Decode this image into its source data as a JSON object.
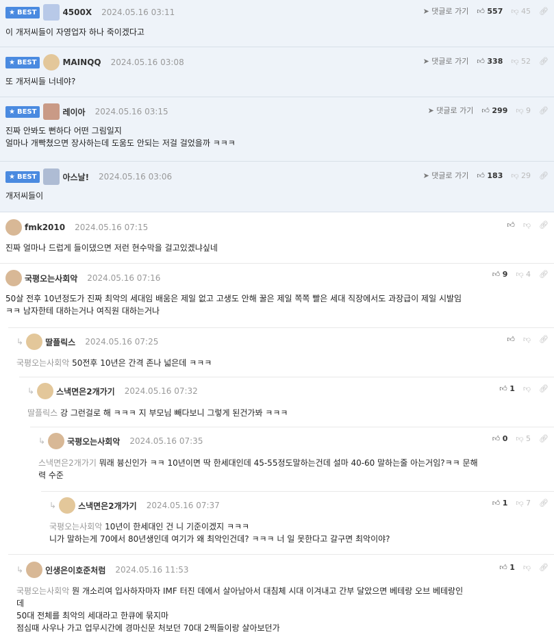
{
  "best_label": "BEST",
  "goto_label": "댓글로 가기",
  "best_comments": [
    {
      "nick": "4500X",
      "date": "2024.05.16 03:11",
      "likes": "557",
      "dislikes": "45",
      "lines": [
        "이 개저씨들이 자영업자 하나 죽이겠다고"
      ]
    },
    {
      "nick": "MAINQQ",
      "date": "2024.05.16 03:08",
      "likes": "338",
      "dislikes": "52",
      "lines": [
        "또 개저씨들 너네야?"
      ]
    },
    {
      "nick": "레이아",
      "date": "2024.05.16 03:15",
      "likes": "299",
      "dislikes": "9",
      "lines": [
        "진짜 안봐도 뻔하다 어떤 그림일지",
        "얼마나 개빡쳤으면 장사하는데 도움도 안되는 저걸 걸었을까 ㅋㅋㅋ"
      ]
    },
    {
      "nick": "아스날!",
      "date": "2024.05.16 03:06",
      "likes": "183",
      "dislikes": "29",
      "lines": [
        "개저씨들이"
      ]
    }
  ],
  "comments": [
    {
      "nick": "fmk2010",
      "date": "2024.05.16 07:15",
      "likes": "",
      "dislikes": "",
      "mention": "",
      "lines": [
        "진짜 얼마나 드럽게 들이댔으면 저런 현수막을 걸고있겠냐싶네"
      ]
    },
    {
      "nick": "국평오는사회악",
      "date": "2024.05.16 07:16",
      "likes": "9",
      "dislikes": "4",
      "mention": "",
      "lines": [
        "50살 전후 10년정도가 진짜 최악의 세대임 배움은 제일 없고 고생도 안해 꿀은 제일 쪽쪽 빨은 세대 직장에서도 과장급이 제일 시발임",
        "ㅋㅋ 남자한테 대하는거나 여직원 대하는거나"
      ]
    },
    {
      "nick": "딸플릭스",
      "date": "2024.05.16 07:25",
      "likes": "",
      "dislikes": "",
      "mention": "국평오는사회악",
      "lines": [
        "50전후 10년은 간격 존나 넓은데 ㅋㅋㅋ"
      ]
    },
    {
      "nick": "스낵면은2개가기",
      "date": "2024.05.16 07:32",
      "likes": "1",
      "dislikes": "",
      "mention": "딸플릭스",
      "lines": [
        "강 그런걸로 해 ㅋㅋㅋ 지 부모님 빼다보니 그렇게 된건가봐 ㅋㅋㅋ"
      ]
    },
    {
      "nick": "국평오는사회악",
      "date": "2024.05.16 07:35",
      "likes": "0",
      "dislikes": "5",
      "mention": "스낵면은2개가기",
      "lines": [
        "뭐래 븅신인가 ㅋㅋ 10년이면 딱 한세대인데 45-55정도말하는건데 설마 40-60 말하는줄 아는거임?ㅋㅋ 문해",
        "력 수준"
      ]
    },
    {
      "nick": "스낵면은2개가기",
      "date": "2024.05.16 07:37",
      "likes": "1",
      "dislikes": "7",
      "mention": "국평오는사회악",
      "lines": [
        "10년이 한세대인 건 니 기준이겠지 ㅋㅋㅋ",
        "니가 말하는게 70에서 80년생인데 여기가 왜 최악인건데? ㅋㅋㅋ 너 일 못한다고 갈구면 최악이야?"
      ]
    },
    {
      "nick": "인생은이호준처럼",
      "date": "2024.05.16 11:53",
      "likes": "1",
      "dislikes": "",
      "mention": "국평오는사회악",
      "lines": [
        "뭔 개소리여 입사하자마자 IMF 터진 데에서 살아남아서 대침체 시대 이겨내고 간부 달았으면 베테랑 오브 베테랑인",
        "데",
        "50대 전체를 최악의 세대라고 한큐에 묶지마",
        "점심때 사우나 가고 업무시간에 경마신문 처보던 70대 2찍들이랑 살아보던가"
      ]
    }
  ]
}
